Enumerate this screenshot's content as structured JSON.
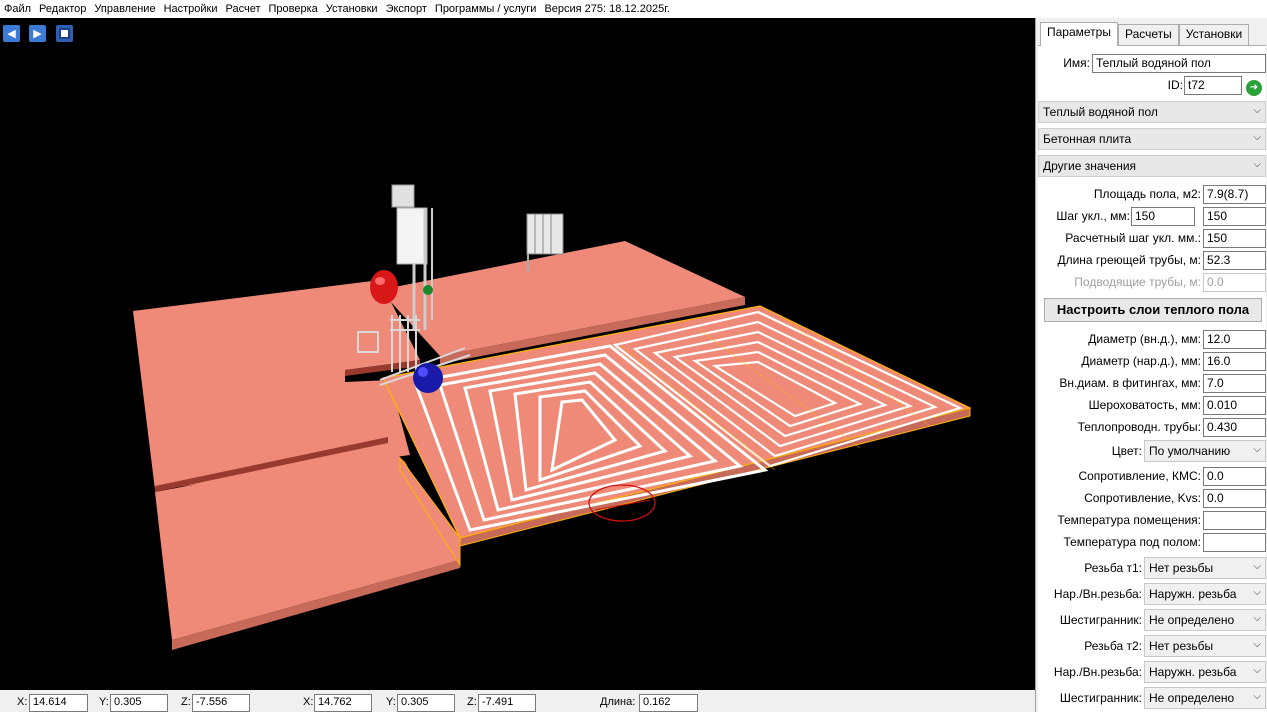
{
  "menu": [
    "Файл",
    "Редактор",
    "Управление",
    "Настройки",
    "Расчет",
    "Проверка",
    "Установки",
    "Экспорт",
    "Программы / услуги",
    "Версия 275: 18.12.2025г."
  ],
  "toolbar": {
    "back_icon": "arrow-left-icon",
    "forward_icon": "arrow-right-icon",
    "save_icon": "floppy-disk-icon"
  },
  "status": {
    "x1_label": "X:",
    "x1": "14.614",
    "y1_label": "Y:",
    "y1": "0.305",
    "z1_label": "Z:",
    "z1": "-7.556",
    "x2_label": "X:",
    "x2": "14.762",
    "y2_label": "Y:",
    "y2": "0.305",
    "z2_label": "Z:",
    "z2": "-7.491",
    "length_label": "Длина:",
    "length": "0.162"
  },
  "panel": {
    "tabs": [
      "Параметры",
      "Расчеты",
      "Установки"
    ],
    "name_label": "Имя:",
    "name": "Теплый водяной пол",
    "id_label": "ID:",
    "id": "t72",
    "go_icon": "arrow-right-circle-icon",
    "dd_type": "Теплый водяной пол",
    "dd_base": "Бетонная плита",
    "dd_other": "Другие значения",
    "area_label": "Площадь пола, м2:",
    "area": "7.9(8.7)",
    "step_label": "Шаг укл., мм:",
    "step": "150",
    "step2": "150",
    "calc_step_label": "Расчетный шаг укл. мм.:",
    "calc_step": "150",
    "pipe_len_label": "Длина греющей трубы, м:",
    "pipe_len": "52.3",
    "supply_label": "Подводящие трубы, м:",
    "supply": "0.0",
    "layers_button": "Настроить слои теплого пола",
    "d_in_label": "Диаметр (вн.д.), мм:",
    "d_in": "12.0",
    "d_out_label": "Диаметр (нар.д.), мм:",
    "d_out": "16.0",
    "d_fit_label": "Вн.диам. в фитингах, мм:",
    "d_fit": "7.0",
    "rough_label": "Шероховатость, мм:",
    "rough": "0.010",
    "cond_label": "Теплопроводн. трубы:",
    "cond": "0.430",
    "color_label": "Цвет:",
    "color": "По умолчанию",
    "kms_label": "Сопротивление, КМС:",
    "kms": "0.0",
    "kvs_label": "Сопротивление, Kvs:",
    "kvs": "0.0",
    "t_room_label": "Температура помещения:",
    "t_room": "",
    "t_under_label": "Температура под полом:",
    "t_under": "",
    "thread1_label": "Резьба т1:",
    "thread1": "Нет резьбы",
    "nv1_label": "Нар./Вн.резьба:",
    "nv1": "Наружн. резьба",
    "hex1_label": "Шестигранник:",
    "hex1": "Не определено",
    "thread2_label": "Резьба т2:",
    "thread2": "Нет резьбы",
    "nv2_label": "Нар./Вн.резьба:",
    "nv2": "Наружн. резьба",
    "hex2_label": "Шестигранник:",
    "hex2": "Не определено"
  },
  "colors": {
    "slab": "#f08a78",
    "pipe": "#ffffff",
    "edge": "#ffb300",
    "marker": "#d01010"
  }
}
